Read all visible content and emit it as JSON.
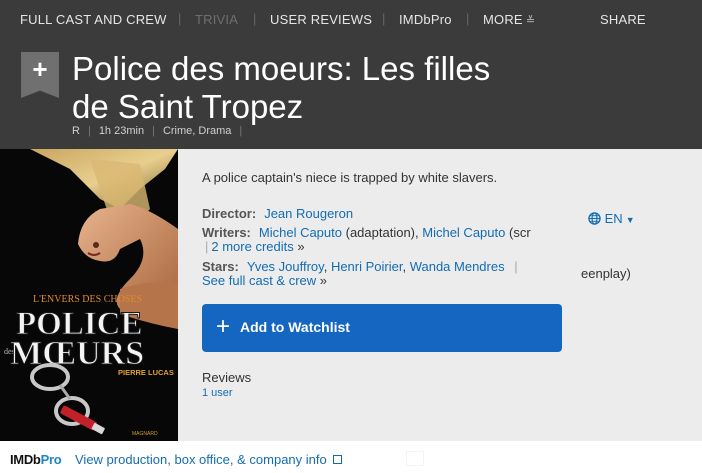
{
  "nav": {
    "items": [
      "FULL CAST AND CREW",
      "TRIVIA",
      "USER REVIEWS",
      "IMDbPro",
      "MORE"
    ],
    "share": "SHARE"
  },
  "header": {
    "ribbon_icon": "plus",
    "title": "Police des moeurs: Les filles de Saint Tropez",
    "rating": "R",
    "runtime": "1h 23min",
    "genres": "Crime, Drama"
  },
  "poster": {
    "top_text": "L'ENVERS DES CHOSES",
    "title_line1": "POLICE",
    "title_small": "des",
    "title_line2": "MŒURS",
    "author": "PIERRE LUCAS"
  },
  "main": {
    "plot": "A police captain's niece is trapped by white slavers.",
    "director_label": "Director:",
    "director": "Jean Rougeron",
    "writers_label": "Writers:",
    "writer1": "Michel Caputo",
    "writer1_role": "(adaptation),",
    "writer2": "Michel Caputo",
    "writer2_role_part": "(scr",
    "writer2_role_rest": "eenplay)",
    "more_credits": "2 more credits",
    "more_arrow": "»",
    "stars_label": "Stars:",
    "star1": "Yves Jouffroy",
    "star2": "Henri Poirier",
    "star3": "Wanda Mendres",
    "full_cast": "See full cast & crew",
    "full_cast_arrow": "»",
    "language": "EN",
    "watchlist_label": "Add to Watchlist",
    "reviews_label": "Reviews",
    "reviews_count": "1 user"
  },
  "pro": {
    "logo_imdb": "IMDb",
    "logo_pro": "Pro",
    "text": "View production, box office, & company info"
  },
  "colors": {
    "header_bg": "#3b3b3b",
    "panel_bg": "#ececec",
    "link": "#136cb2",
    "watchlist": "#1466c0"
  }
}
